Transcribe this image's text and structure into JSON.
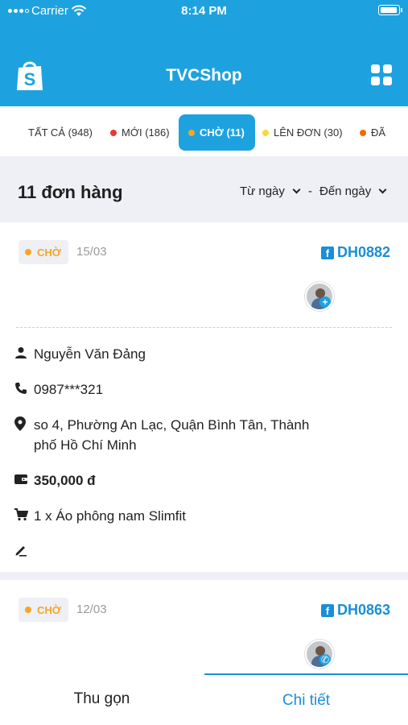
{
  "status_bar": {
    "carrier": "Carrier",
    "time": "8:14 PM"
  },
  "header": {
    "title": "TVCShop",
    "logo_icon": "shopping-bag-icon",
    "menu_icon": "grid-icon"
  },
  "tabs": [
    {
      "label": "TẤT CẢ (948)",
      "dot": ""
    },
    {
      "label": "MỚI (186)",
      "dot": "#e53935"
    },
    {
      "label": "CHỜ (11)",
      "dot": "#f5a623",
      "active": true
    },
    {
      "label": "LÊN ĐƠN (30)",
      "dot": "#fdd835"
    },
    {
      "label": "ĐÃ",
      "dot": "#ef6c00"
    }
  ],
  "summary": {
    "count": "11 đơn hàng",
    "from_date": "Từ ngày",
    "separator": "-",
    "to_date": "Đến ngày"
  },
  "orders": [
    {
      "status": "CHỜ",
      "date": "15/03",
      "code": "DH0882",
      "customer": "Nguyễn Văn Đảng",
      "phone": "0987***321",
      "address": "so 4, Phường  An Lạc, Quận Bình Tân, Thành phố Hồ Chí Minh",
      "total": "350,000 đ",
      "items": "1 x Áo phông nam Slimfit",
      "note": ""
    },
    {
      "status": "CHỜ",
      "date": "12/03",
      "code": "DH0863"
    }
  ],
  "bottom_tabs": {
    "collapse": "Thu gọn",
    "detail": "Chi tiết"
  },
  "colors": {
    "primary": "#1ea2df",
    "link": "#1a8fd6",
    "waiting": "#f5a623",
    "background": "#eef0f5"
  }
}
